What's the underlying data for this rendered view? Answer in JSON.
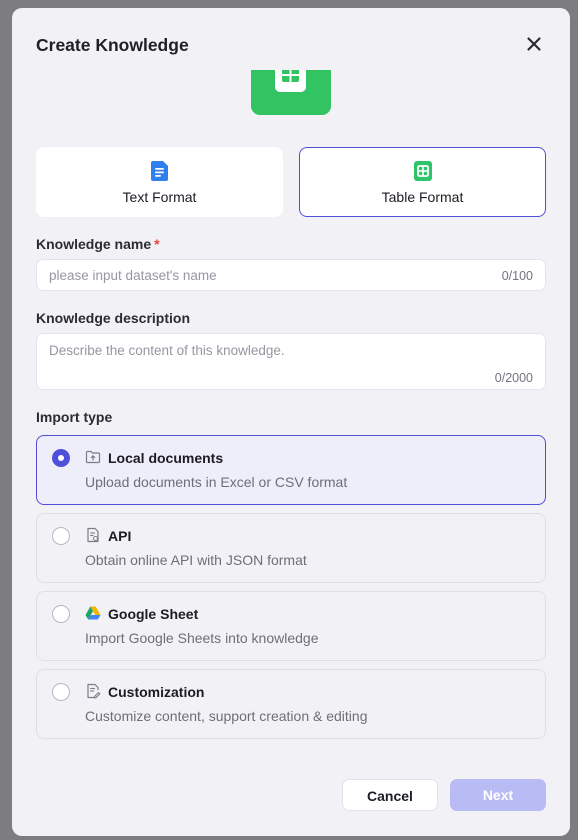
{
  "dialog": {
    "title": "Create Knowledge",
    "close_icon": "close-icon"
  },
  "format_tabs": [
    {
      "label": "Text Format",
      "icon": "text-doc-icon",
      "selected": false,
      "color": "#2f80ed"
    },
    {
      "label": "Table Format",
      "icon": "table-icon",
      "selected": true,
      "color": "#2fc36a"
    }
  ],
  "name_field": {
    "label": "Knowledge name",
    "required_mark": "*",
    "placeholder": "please input dataset's name",
    "counter": "0/100"
  },
  "description_field": {
    "label": "Knowledge description",
    "placeholder": "Describe the content of this knowledge.",
    "counter": "0/2000"
  },
  "import_type": {
    "label": "Import type",
    "options": [
      {
        "title": "Local documents",
        "description": "Upload documents in Excel or CSV format",
        "icon": "upload-folder-icon",
        "selected": true
      },
      {
        "title": "API",
        "description": "Obtain online API with JSON format",
        "icon": "api-doc-icon",
        "selected": false
      },
      {
        "title": "Google Sheet",
        "description": "Import Google Sheets into knowledge",
        "icon": "google-drive-icon",
        "selected": false
      },
      {
        "title": "Customization",
        "description": "Customize content, support creation & editing",
        "icon": "edit-doc-icon",
        "selected": false
      }
    ]
  },
  "footer": {
    "cancel_label": "Cancel",
    "next_label": "Next"
  },
  "colors": {
    "accent": "#4e4fd9",
    "next_disabled": "#b9bbf5",
    "hero_green": "#32c463",
    "required": "#f1413c"
  }
}
